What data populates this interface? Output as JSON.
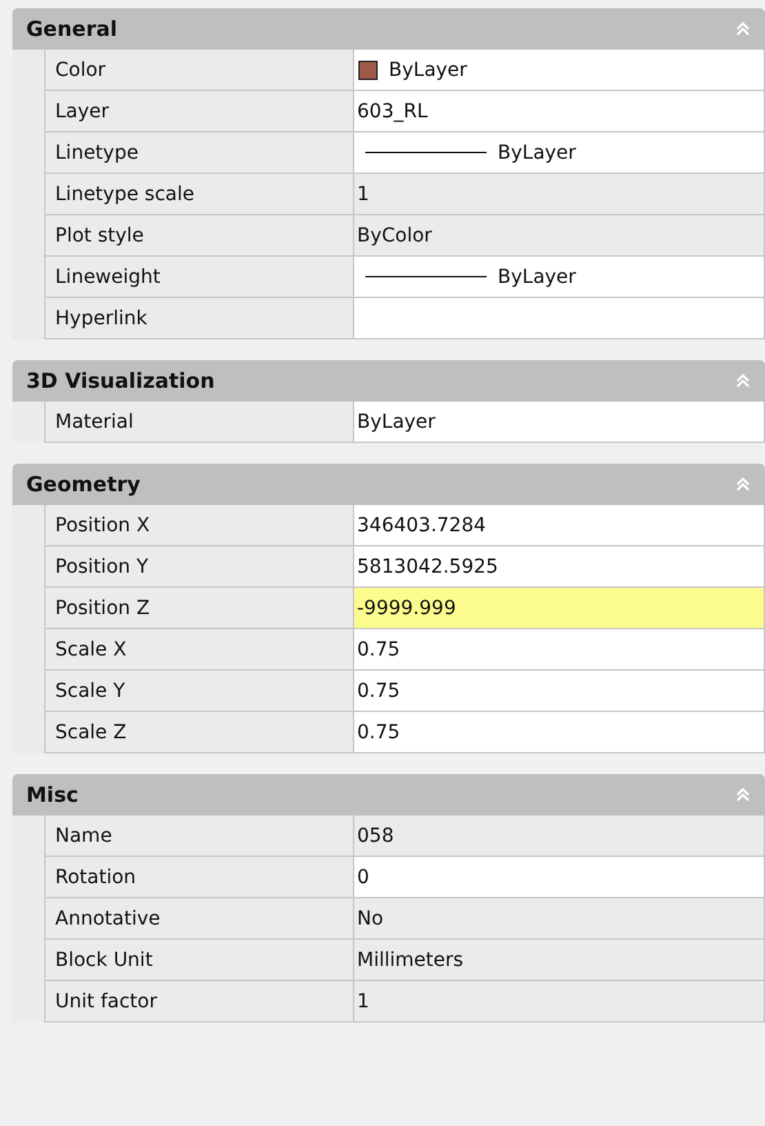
{
  "sections": [
    {
      "title": "General",
      "expanded": true,
      "rows": [
        {
          "label": "Color",
          "value": "ByLayer",
          "kind": "color",
          "color": "#9c5a48",
          "editable": true,
          "highlighted": false
        },
        {
          "label": "Layer",
          "value": "603_RL",
          "kind": "text",
          "editable": true,
          "highlighted": false
        },
        {
          "label": "Linetype",
          "value": "ByLayer",
          "kind": "line",
          "editable": true,
          "highlighted": false
        },
        {
          "label": "Linetype scale",
          "value": "1",
          "kind": "text",
          "editable": false,
          "highlighted": false
        },
        {
          "label": "Plot style",
          "value": "ByColor",
          "kind": "text",
          "editable": false,
          "highlighted": false
        },
        {
          "label": "Lineweight",
          "value": "ByLayer",
          "kind": "line",
          "editable": true,
          "highlighted": false
        },
        {
          "label": "Hyperlink",
          "kind": "text",
          "editable": true,
          "highlighted": false
        }
      ]
    },
    {
      "title": "3D Visualization",
      "expanded": true,
      "rows": [
        {
          "label": "Material",
          "value": "ByLayer",
          "kind": "text",
          "editable": true,
          "highlighted": false
        }
      ]
    },
    {
      "title": "Geometry",
      "expanded": true,
      "rows": [
        {
          "label": "Position X",
          "value": "346403.7284",
          "kind": "text",
          "editable": true,
          "highlighted": false
        },
        {
          "label": "Position Y",
          "value": "5813042.5925",
          "kind": "text",
          "editable": true,
          "highlighted": false
        },
        {
          "label": "Position Z",
          "value": "-9999.999",
          "kind": "text",
          "editable": true,
          "highlighted": true
        },
        {
          "label": "Scale X",
          "value": "0.75",
          "kind": "text",
          "editable": true,
          "highlighted": false
        },
        {
          "label": "Scale Y",
          "value": "0.75",
          "kind": "text",
          "editable": true,
          "highlighted": false
        },
        {
          "label": "Scale Z",
          "value": "0.75",
          "kind": "text",
          "editable": true,
          "highlighted": false
        }
      ]
    },
    {
      "title": "Misc",
      "expanded": true,
      "rows": [
        {
          "label": "Name",
          "value": "058",
          "kind": "text",
          "editable": false,
          "highlighted": false
        },
        {
          "label": "Rotation",
          "value": "0",
          "kind": "text",
          "editable": true,
          "highlighted": false
        },
        {
          "label": "Annotative",
          "value": "No",
          "kind": "text",
          "editable": false,
          "highlighted": false
        },
        {
          "label": "Block Unit",
          "value": "Millimeters",
          "kind": "text",
          "editable": false,
          "highlighted": false
        },
        {
          "label": "Unit factor",
          "value": "1",
          "kind": "text",
          "editable": false,
          "highlighted": false
        }
      ]
    }
  ]
}
